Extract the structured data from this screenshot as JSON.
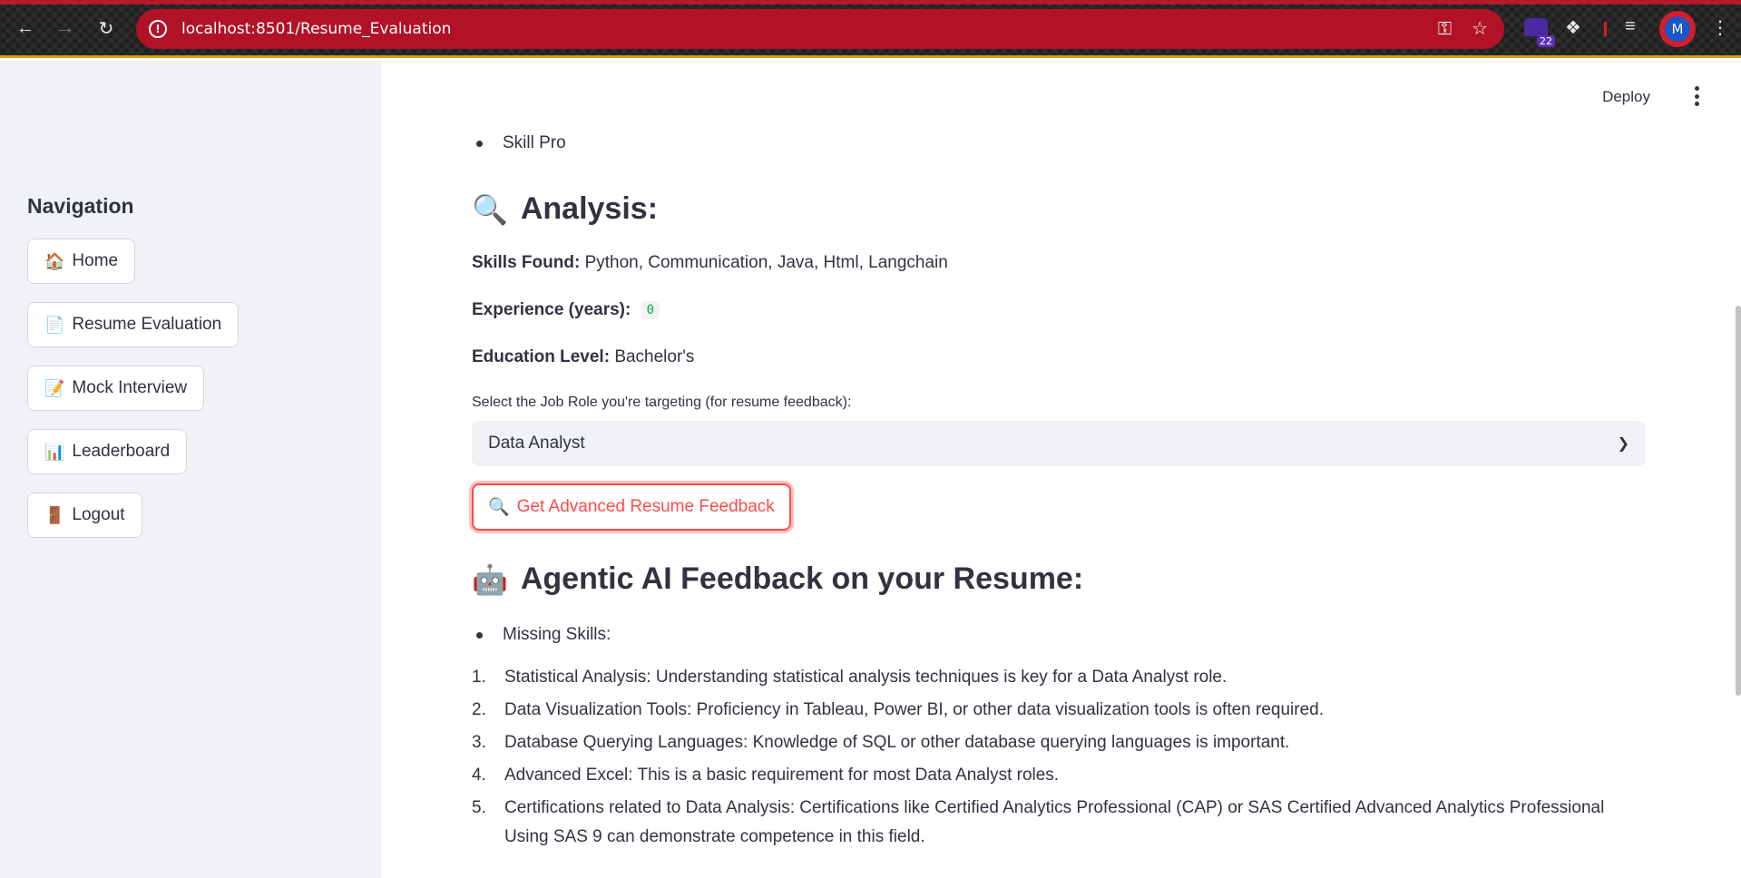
{
  "browser": {
    "url": "localhost:8501/Resume_Evaluation",
    "extension_badge": "22",
    "avatar_letter": "M"
  },
  "sidebar": {
    "title": "Navigation",
    "items": [
      {
        "icon": "🏠",
        "label": "Home"
      },
      {
        "icon": "📄",
        "label": "Resume Evaluation"
      },
      {
        "icon": "📝",
        "label": "Mock Interview"
      },
      {
        "icon": "📊",
        "label": "Leaderboard"
      },
      {
        "icon": "🚪",
        "label": "Logout"
      }
    ]
  },
  "header": {
    "deploy_label": "Deploy"
  },
  "main": {
    "top_bullet": "Skill Pro",
    "analysis": {
      "icon": "🔍",
      "heading": "Analysis:",
      "skills_label": "Skills Found:",
      "skills_value": "Python, Communication, Java, Html, Langchain",
      "experience_label": "Experience (years):",
      "experience_value": "0",
      "education_label": "Education Level:",
      "education_value": "Bachelor's"
    },
    "job_role": {
      "label": "Select the Job Role you're targeting (for resume feedback):",
      "selected": "Data Analyst"
    },
    "feedback_button": {
      "icon": "🔍",
      "label": "Get Advanced Resume Feedback"
    },
    "feedback": {
      "icon": "🤖",
      "heading": "Agentic AI Feedback on your Resume:",
      "bullet": "Missing Skills:",
      "items": [
        {
          "num": "1.",
          "text": "Statistical Analysis: Understanding statistical analysis techniques is key for a Data Analyst role."
        },
        {
          "num": "2.",
          "text": "Data Visualization Tools: Proficiency in Tableau, Power BI, or other data visualization tools is often required."
        },
        {
          "num": "3.",
          "text": "Database Querying Languages: Knowledge of SQL or other database querying languages is important."
        },
        {
          "num": "4.",
          "text": "Advanced Excel: This is a basic requirement for most Data Analyst roles."
        },
        {
          "num": "5.",
          "text": "Certifications related to Data Analysis: Certifications like Certified Analytics Professional (CAP) or SAS Certified Advanced Analytics Professional Using SAS 9 can demonstrate competence in this field."
        }
      ]
    }
  }
}
